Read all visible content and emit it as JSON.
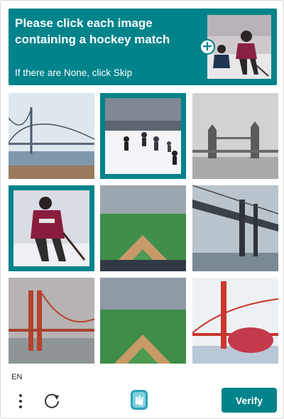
{
  "challenge": {
    "prompt": "Please click each image containing a hockey match",
    "hint": "If there are None, click Skip"
  },
  "footer": {
    "language": "EN",
    "verify_label": "Verify"
  },
  "icons": [
    "plus-icon",
    "more-vert-icon",
    "refresh-icon",
    "hcaptcha-logo-icon"
  ],
  "tiles": [
    {
      "subject": "suspension bridge over water",
      "selected": false
    },
    {
      "subject": "hockey match on ice",
      "selected": true
    },
    {
      "subject": "tower bridge grayscale",
      "selected": false
    },
    {
      "subject": "hockey player",
      "selected": true
    },
    {
      "subject": "baseball stadium",
      "selected": false
    },
    {
      "subject": "bridge from below",
      "selected": false
    },
    {
      "subject": "golden gate bridge",
      "selected": false
    },
    {
      "subject": "baseball field",
      "selected": false
    },
    {
      "subject": "red bridge with globe",
      "selected": false
    }
  ],
  "colors": {
    "accent": "#00838a",
    "border": "#d6d6d6"
  }
}
